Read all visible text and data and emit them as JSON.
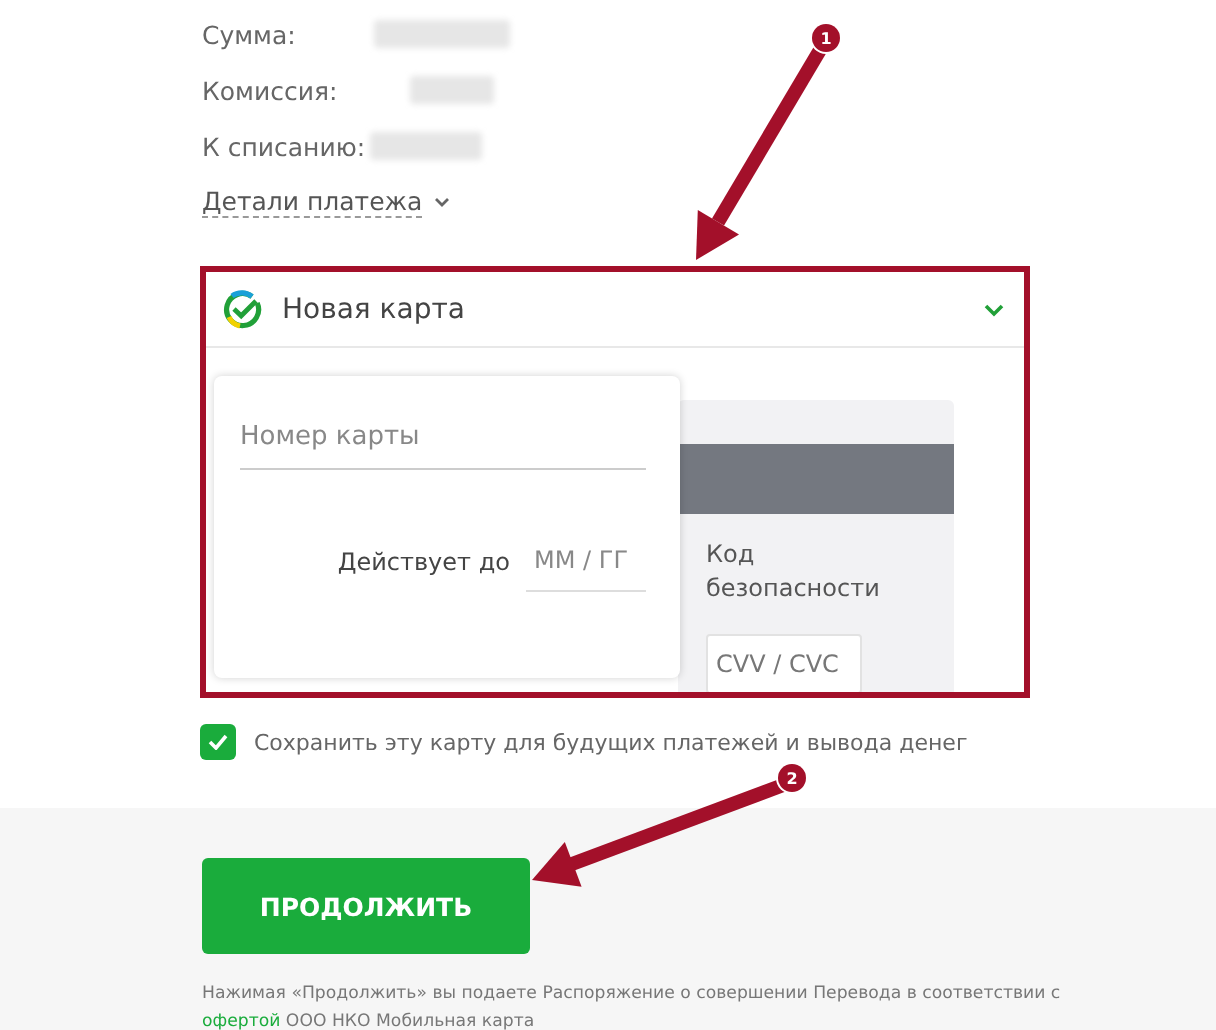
{
  "summary": {
    "rows": [
      {
        "label": "Сумма:"
      },
      {
        "label": "Комиссия:"
      },
      {
        "label": "К списанию:"
      }
    ],
    "details_link": "Детали платежа"
  },
  "card_form": {
    "title": "Новая карта",
    "expanded": true,
    "card_number": {
      "placeholder": "Номер карты"
    },
    "expiry": {
      "label": "Действует до",
      "placeholder": "ММ / ГГ"
    },
    "cvv": {
      "label": "Код безопасности",
      "placeholder": "CVV / CVC"
    }
  },
  "save_card": {
    "checked": true,
    "label": "Сохранить эту карту для будущих платежей и вывода денег"
  },
  "continue_button": "ПРОДОЛЖИТЬ",
  "disclaimer": {
    "text_before": "Нажимая «Продолжить» вы подаете Распоряжение о совершении Перевода в соответствии с ",
    "link": "офертой",
    "text_after": " ООО НКО Мобильная карта"
  },
  "annotations": [
    {
      "label": "1"
    },
    {
      "label": "2"
    }
  ]
}
